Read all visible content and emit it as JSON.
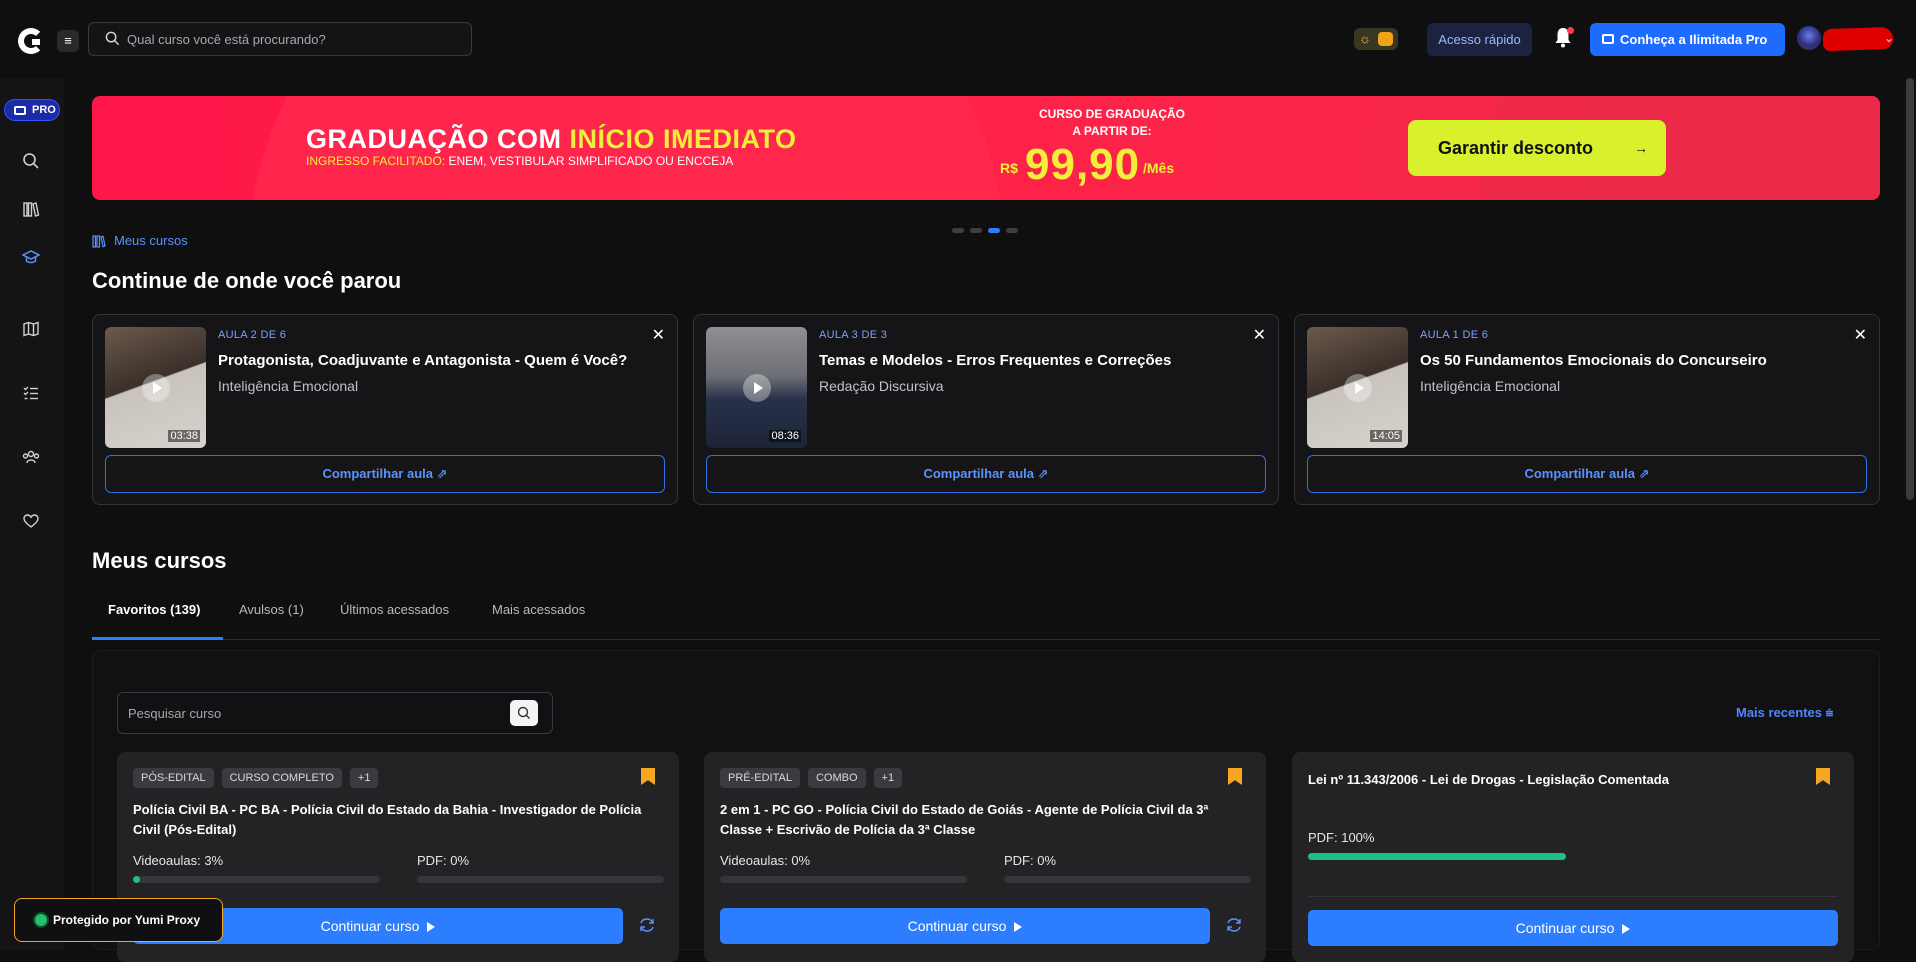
{
  "topbar": {
    "search_placeholder": "Qual curso você está procurando?",
    "quick_access": "Acesso rápido",
    "pro_cta": "Conheça a Ilimitada Pro"
  },
  "sidebar": {
    "pro_badge": "PRO",
    "items": [
      "search-icon",
      "library-icon",
      "graduation-cap-icon",
      "map-icon",
      "checklist-icon",
      "community-icon",
      "heart-icon"
    ]
  },
  "banner": {
    "title_part1": "GRADUAÇÃO COM ",
    "title_highlight": "INÍCIO IMEDIATO",
    "subtitle_highlight": "INGRESSO FACILITADO:",
    "subtitle_rest": " ENEM, VESTIBULAR SIMPLIFICADO OU ENCCEJA",
    "price_caption_1": "CURSO DE GRADUAÇÃO",
    "price_caption_2": "A PARTIR DE:",
    "currency": "R$",
    "price": "99,90",
    "period": "/Mês",
    "cta": "Garantir desconto",
    "carousel_count": 4,
    "carousel_active": 3
  },
  "breadcrumb": "Meus cursos",
  "continue_section": {
    "title": "Continue de onde você parou",
    "share_label": "Compartilhar aula",
    "lessons": [
      {
        "aula": "AULA 2 DE 6",
        "title": "Protagonista, Coadjuvante e Antagonista - Quem é Você?",
        "course": "Inteligência Emocional",
        "duration": "03:38"
      },
      {
        "aula": "AULA 3 DE 3",
        "title": "Temas e Modelos - Erros Frequentes e Correções",
        "course": "Redação Discursiva",
        "duration": "08:36"
      },
      {
        "aula": "AULA 1 DE 6",
        "title": "Os 50 Fundamentos Emocionais do Concurseiro",
        "course": "Inteligência Emocional",
        "duration": "14:05"
      }
    ]
  },
  "my_courses": {
    "title": "Meus cursos",
    "tabs": [
      "Favoritos (139)",
      "Avulsos (1)",
      "Últimos acessados",
      "Mais acessados"
    ],
    "search_placeholder": "Pesquisar curso",
    "sort_label": "Mais recentes",
    "continue_label": "Continuar curso",
    "courses": [
      {
        "tags": [
          "PÓS-EDITAL",
          "CURSO COMPLETO",
          "+1"
        ],
        "title": "Polícia Civil BA - PC BA - Polícia Civil do Estado da Bahia - Investigador de Polícia Civil (Pós-Edital)",
        "video_label": "Videoaulas: 3%",
        "video_progress": 0.03,
        "pdf_label": "PDF: 0%",
        "pdf_progress": 0
      },
      {
        "tags": [
          "PRÉ-EDITAL",
          "COMBO",
          "+1"
        ],
        "title": "2 em 1 - PC GO - Polícia Civil do Estado de Goiás - Agente de Polícia Civil da 3ª Classe + Escrivão de Polícia da 3ª Classe",
        "video_label": "Videoaulas: 0%",
        "video_progress": 0,
        "pdf_label": "PDF: 0%",
        "pdf_progress": 0
      },
      {
        "tags": [],
        "title": "Lei nº 11.343/2006 - Lei de Drogas - Legislação Comentada",
        "pdf_label": "PDF: 100%",
        "pdf_progress": 1
      }
    ]
  },
  "proxy_badge": "Protegido por Yumi Proxy",
  "colors": {
    "accent": "#2d7dff",
    "banner": "#ff1749",
    "highlight": "#f2ef3b",
    "cta": "#d8f12c",
    "bookmark": "#f5a623",
    "progress_done": "#1dbf84"
  }
}
